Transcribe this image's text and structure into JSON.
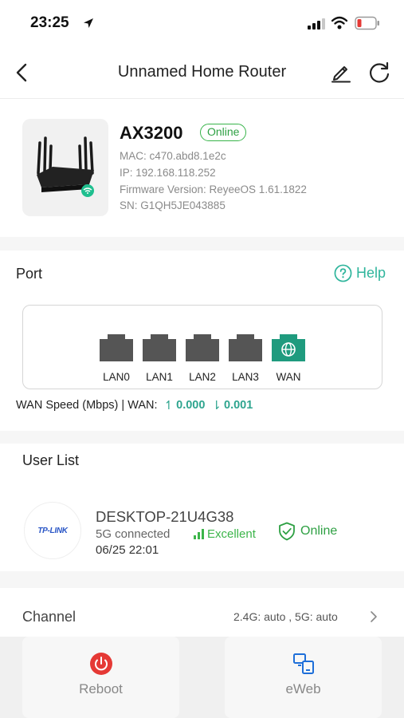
{
  "status_bar": {
    "time": "23:25"
  },
  "nav": {
    "title": "Unnamed Home Router"
  },
  "device": {
    "model": "AX3200",
    "status": "Online",
    "mac": "MAC: c470.abd8.1e2c",
    "ip": "IP: 192.168.118.252",
    "firmware": "Firmware Version: ReyeeOS 1.61.1822",
    "sn": "SN: G1QH5JE043885"
  },
  "port": {
    "title": "Port",
    "help_label": "Help",
    "ports": [
      {
        "label": "LAN0",
        "active": false
      },
      {
        "label": "LAN1",
        "active": false
      },
      {
        "label": "LAN2",
        "active": false
      },
      {
        "label": "LAN3",
        "active": false
      },
      {
        "label": "WAN",
        "active": true
      }
    ],
    "wan_speed_label": "WAN Speed (Mbps) | WAN:",
    "upload": "0.000",
    "download": "0.001",
    "accent_color": "#2fa58f"
  },
  "user_list": {
    "title": "User List",
    "client": {
      "logo_text": "TP-LINK",
      "name": "DESKTOP-21U4G38",
      "connection": "5G connected",
      "signal": "Excellent",
      "time": "06/25 22:01",
      "status": "Online"
    }
  },
  "channel": {
    "label": "Channel",
    "value": "2.4G: auto , 5G: auto"
  },
  "actions": {
    "reboot_label": "Reboot",
    "eweb_label": "eWeb"
  }
}
